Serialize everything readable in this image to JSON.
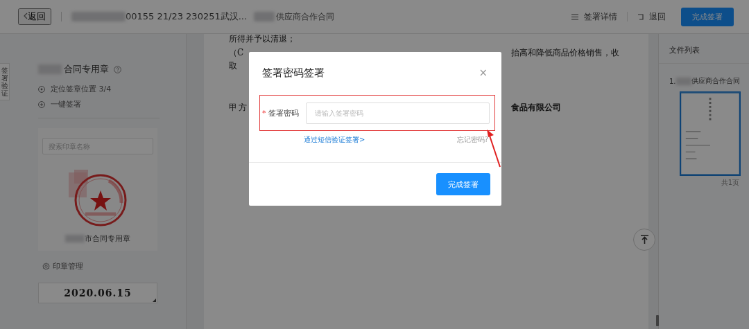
{
  "top_bar": {
    "back": "返回",
    "title_parts": [
      "00155 21/23 230251武汉...",
      "供应商合作合同"
    ],
    "actions": [
      {
        "kind": "details",
        "label": "签署详情"
      },
      {
        "kind": "return",
        "label": "退回"
      },
      {
        "kind": "primary",
        "label": "完成签署"
      }
    ]
  },
  "side_tab": "签署验证",
  "seal_panel": {
    "title": "合同专用章",
    "steps": [
      {
        "kind": "locate",
        "label": "定位签章位置 3/4"
      },
      {
        "kind": "one_click",
        "label": "一键签署"
      }
    ],
    "search": {
      "placeholder": "搜索印章名称"
    },
    "seal": {
      "caption": "市合同专用章"
    },
    "manage": "印章管理",
    "date": "2020.06.15"
  },
  "document": {
    "lines": [
      {
        "left": "所得并予以清退；"
      },
      {
        "left": "（C",
        "right": "抬高和降低商品价格销售，收"
      },
      {
        "left": "取"
      },
      {
        "left": "甲 方",
        "right": "食品有限公司",
        "bold_right": true
      }
    ]
  },
  "file_list": {
    "title": "文件列表",
    "files": [
      {
        "index": "1.",
        "name": "供应商合作合同",
        "selected": true,
        "pages": "共1页"
      }
    ]
  },
  "dialog": {
    "title": "签署密码签署",
    "close": "×",
    "field": {
      "required_mark": "*",
      "label": "签署密码",
      "placeholder": "请输入签署密码"
    },
    "sms_link": "通过短信验证签署>",
    "forgot": "忘记密码?",
    "submit": "完成签署"
  }
}
